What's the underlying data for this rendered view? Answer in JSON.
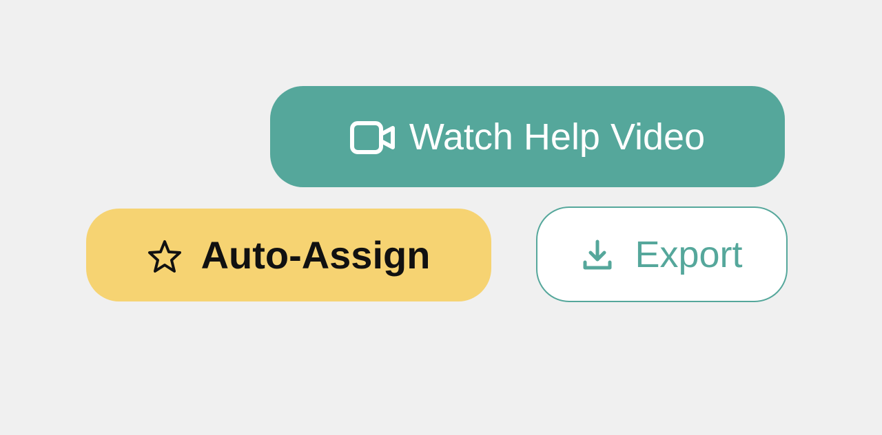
{
  "buttons": {
    "watch_video_label": "Watch Help Video",
    "auto_assign_label": "Auto-Assign",
    "export_label": "Export"
  },
  "colors": {
    "teal": "#55a79b",
    "yellow": "#f6d372",
    "white": "#ffffff",
    "dark": "#111111",
    "background": "#f0f0f0"
  }
}
